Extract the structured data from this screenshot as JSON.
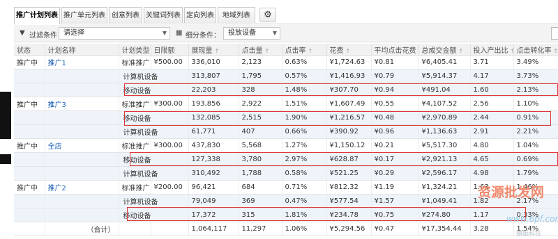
{
  "tabs": [
    {
      "label": "推广计划列表",
      "active": true
    },
    {
      "label": "推广单元列表",
      "active": false
    },
    {
      "label": "创意列表",
      "active": false
    },
    {
      "label": "关键词列表",
      "active": false
    },
    {
      "label": "定向列表",
      "active": false
    },
    {
      "label": "地域列表",
      "active": false
    }
  ],
  "gear_icon": "gear-icon",
  "filter": {
    "label": "过滤条件：",
    "value": "请选择",
    "detail_label": "细分条件：",
    "detail_value": "投放设备"
  },
  "columns": [
    "状态",
    "计划名称",
    "计划类型",
    "日限额",
    "展现量",
    "点击量",
    "点击率",
    "花费",
    "平均点击花费",
    "总成交金额",
    "投入产出比",
    "点击转化率"
  ],
  "rows": [
    {
      "kind": "main",
      "status": "推广中",
      "name": "推广1",
      "type": "标准推广",
      "budget": "¥500.00",
      "impressions": "336,010",
      "clicks": "2,123",
      "ctr": "0.63%",
      "cost": "¥1,724.63",
      "cpc": "¥0.81",
      "gmv": "¥6,405.41",
      "roi": "3.71",
      "cvr": "3.49%"
    },
    {
      "kind": "sub",
      "device": "计算机设备",
      "impressions": "313,807",
      "clicks": "1,795",
      "ctr": "0.57%",
      "cost": "¥1,416.93",
      "cpc": "¥0.79",
      "gmv": "¥5,914.37",
      "roi": "4.17",
      "cvr": "3.73%"
    },
    {
      "kind": "sub",
      "device": "移动设备",
      "impressions": "22,203",
      "clicks": "328",
      "ctr": "1.48%",
      "cost": "¥307.70",
      "cpc": "¥0.94",
      "gmv": "¥491.04",
      "roi": "1.60",
      "cvr": "2.13%"
    },
    {
      "kind": "main",
      "status": "推广中",
      "name": "推广3",
      "type": "标准推广",
      "budget": "¥300.00",
      "impressions": "193,856",
      "clicks": "2,922",
      "ctr": "1.51%",
      "cost": "¥1,607.49",
      "cpc": "¥0.55",
      "gmv": "¥4,107.52",
      "roi": "2.56",
      "cvr": "1.10%"
    },
    {
      "kind": "sub",
      "device": "移动设备",
      "impressions": "132,085",
      "clicks": "2,515",
      "ctr": "1.90%",
      "cost": "¥1,216.57",
      "cpc": "¥0.48",
      "gmv": "¥2,970.89",
      "roi": "2.44",
      "cvr": "0.91%"
    },
    {
      "kind": "sub",
      "device": "计算机设备",
      "impressions": "61,771",
      "clicks": "407",
      "ctr": "0.66%",
      "cost": "¥390.92",
      "cpc": "¥0.96",
      "gmv": "¥1,136.63",
      "roi": "2.91",
      "cvr": "2.21%"
    },
    {
      "kind": "main",
      "status": "推广中",
      "name": "全店",
      "type": "标准推广",
      "budget": "¥300.00",
      "impressions": "437,830",
      "clicks": "5,568",
      "ctr": "1.27%",
      "cost": "¥1,150.12",
      "cpc": "¥0.21",
      "gmv": "¥5,517.30",
      "roi": "4.80",
      "cvr": "1.04%"
    },
    {
      "kind": "sub",
      "device": "移动设备",
      "impressions": "127,338",
      "clicks": "3,780",
      "ctr": "2.97%",
      "cost": "¥628.87",
      "cpc": "¥0.17",
      "gmv": "¥2,921.13",
      "roi": "4.65",
      "cvr": "0.69%"
    },
    {
      "kind": "sub",
      "device": "计算机设备",
      "impressions": "310,492",
      "clicks": "1,788",
      "ctr": "0.58%",
      "cost": "¥521.25",
      "cpc": "¥0.29",
      "gmv": "¥2,596.17",
      "roi": "4.98",
      "cvr": "1.79%"
    },
    {
      "kind": "main",
      "status": "推广中",
      "name": "推广2",
      "type": "标准推广",
      "budget": "¥200.00",
      "impressions": "96,421",
      "clicks": "684",
      "ctr": "0.71%",
      "cost": "¥812.32",
      "cpc": "¥1.19",
      "gmv": "¥1,324.21",
      "roi": "1.63",
      "cvr": "1.46%"
    },
    {
      "kind": "sub",
      "device": "计算机设备",
      "impressions": "79,049",
      "clicks": "369",
      "ctr": "0.47%",
      "cost": "¥577.54",
      "cpc": "¥1.57",
      "gmv": "¥1,049.41",
      "roi": "1.82",
      "cvr": "2.17%"
    },
    {
      "kind": "sub",
      "device": "移动设备",
      "impressions": "17,372",
      "clicks": "315",
      "ctr": "1.81%",
      "cost": "¥234.78",
      "cpc": "¥0.75",
      "gmv": "¥274.80",
      "roi": "1.17",
      "cvr": "0.33%"
    },
    {
      "kind": "total",
      "label": "（合计）",
      "impressions": "1,064,117",
      "clicks": "11,297",
      "ctr": "1.06%",
      "cost": "¥5,294.56",
      "cpc": "¥0.47",
      "gmv": "¥17,354.44",
      "roi": "3.28",
      "cvr": "1.54%"
    }
  ],
  "watermark": {
    "line1": "资源批发网",
    "line2": "www.6pf.com",
    "line3": "蜻蜓科技"
  },
  "colors": {
    "highlight": "#e0383a",
    "link": "#1a5fb4",
    "sub_row_bg": "#eef4fa",
    "watermark": "#f08a6e"
  }
}
